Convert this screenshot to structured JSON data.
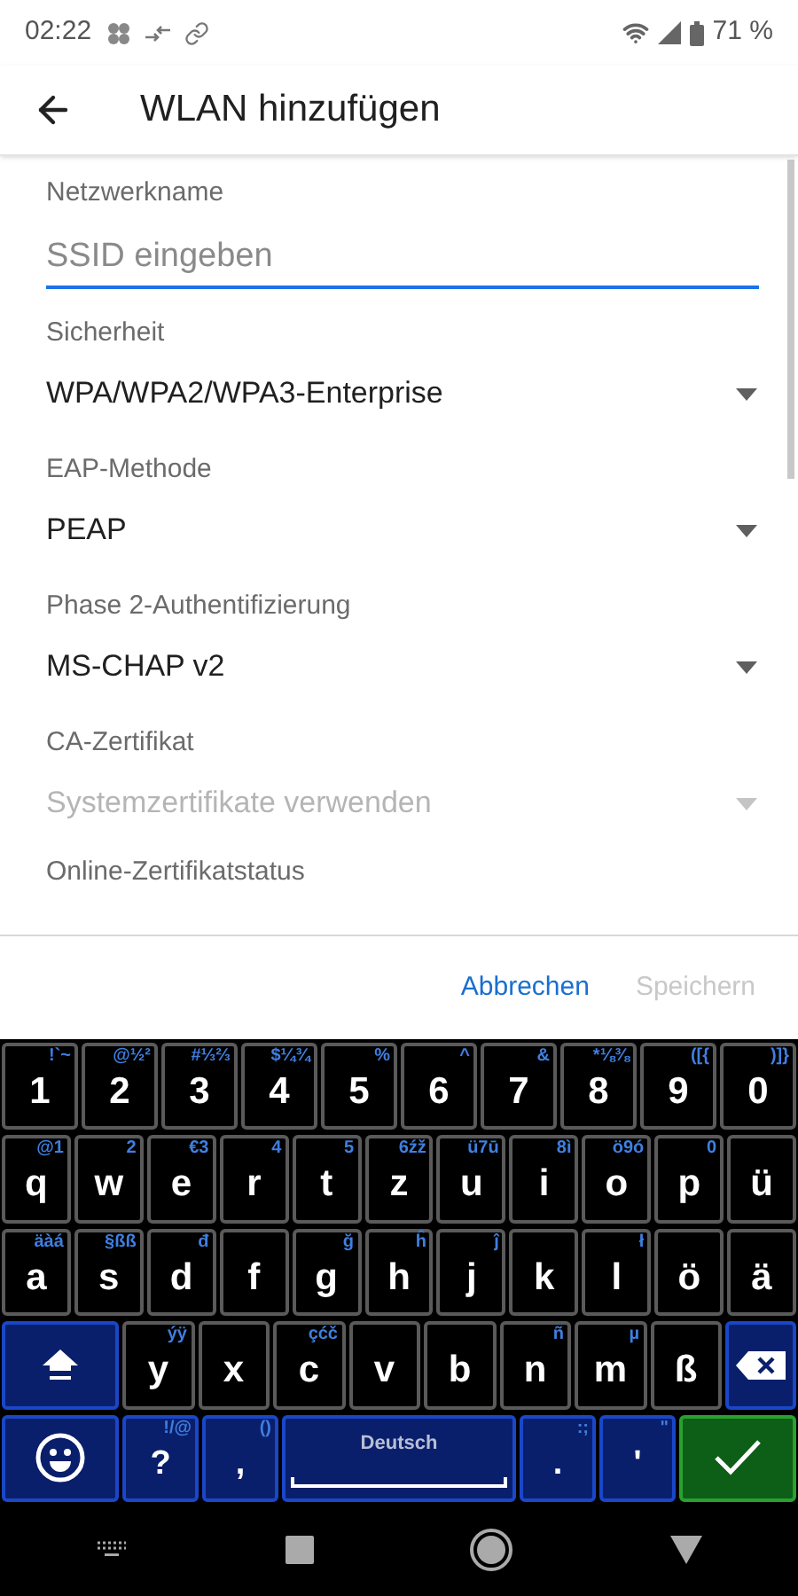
{
  "status_bar": {
    "time": "02:22",
    "battery": "71 %"
  },
  "app_bar": {
    "title": "WLAN hinzufügen"
  },
  "form": {
    "fields": [
      {
        "kind": "input",
        "label": "Netzwerkname",
        "placeholder": "SSID eingeben",
        "focused": true
      },
      {
        "kind": "dropdown",
        "label": "Sicherheit",
        "value": "WPA/WPA2/WPA3-Enterprise",
        "disabled": false
      },
      {
        "kind": "dropdown",
        "label": "EAP-Methode",
        "value": "PEAP",
        "disabled": false
      },
      {
        "kind": "dropdown",
        "label": "Phase 2-Authentifizierung",
        "value": "MS-CHAP v2",
        "disabled": false
      },
      {
        "kind": "dropdown",
        "label": "CA-Zertifikat",
        "value": "Systemzertifikate verwenden",
        "disabled": true
      },
      {
        "kind": "partial",
        "label": "Online-Zertifikatstatus"
      }
    ]
  },
  "dialog_buttons": [
    {
      "label": "Abbrechen",
      "disabled": false
    },
    {
      "label": "Speichern",
      "disabled": true
    }
  ],
  "keyboard": {
    "number_keys": [
      {
        "kind": "char",
        "label": "1",
        "hint": "!`~"
      },
      {
        "kind": "char",
        "label": "2",
        "hint": "@½²"
      },
      {
        "kind": "char",
        "label": "3",
        "hint": "#⅓⅔"
      },
      {
        "kind": "char",
        "label": "4",
        "hint": "$¼¾"
      },
      {
        "kind": "char",
        "label": "5",
        "hint": "%"
      },
      {
        "kind": "char",
        "label": "6",
        "hint": "^"
      },
      {
        "kind": "char",
        "label": "7",
        "hint": "&"
      },
      {
        "kind": "char",
        "label": "8",
        "hint": "*⅛⅜"
      },
      {
        "kind": "char",
        "label": "9",
        "hint": "([{"
      },
      {
        "kind": "char",
        "label": "0",
        "hint": ")]}"
      }
    ],
    "upper_letter_keys": [
      {
        "kind": "char",
        "label": "q",
        "hint": "@1"
      },
      {
        "kind": "char",
        "label": "w",
        "hint": "2"
      },
      {
        "kind": "char",
        "label": "e",
        "hint": "€3"
      },
      {
        "kind": "char",
        "label": "r",
        "hint": "4"
      },
      {
        "kind": "char",
        "label": "t",
        "hint": "5"
      },
      {
        "kind": "char",
        "label": "z",
        "hint": "6źž"
      },
      {
        "kind": "char",
        "label": "u",
        "hint": "ü7ū"
      },
      {
        "kind": "char",
        "label": "i",
        "hint": "8ì"
      },
      {
        "kind": "char",
        "label": "o",
        "hint": "ö9ó"
      },
      {
        "kind": "char",
        "label": "p",
        "hint": "0"
      },
      {
        "kind": "char",
        "label": "ü"
      }
    ],
    "middle_letter_keys": [
      {
        "kind": "char",
        "label": "a",
        "hint": "äàá"
      },
      {
        "kind": "char",
        "label": "s",
        "hint": "§ßß"
      },
      {
        "kind": "char",
        "label": "d",
        "hint": "đ"
      },
      {
        "kind": "char",
        "label": "f"
      },
      {
        "kind": "char",
        "label": "g",
        "hint": "ğ"
      },
      {
        "kind": "char",
        "label": "h",
        "hint": "ĥ"
      },
      {
        "kind": "char",
        "label": "j",
        "hint": "ĵ"
      },
      {
        "kind": "char",
        "label": "k"
      },
      {
        "kind": "char",
        "label": "l",
        "hint": "ł"
      },
      {
        "kind": "char",
        "label": "ö"
      },
      {
        "kind": "char",
        "label": "ä"
      }
    ],
    "lower_letter_keys": [
      {
        "kind": "shift"
      },
      {
        "kind": "char",
        "label": "y",
        "hint": "ýÿ"
      },
      {
        "kind": "char",
        "label": "x"
      },
      {
        "kind": "char",
        "label": "c",
        "hint": "çćč"
      },
      {
        "kind": "char",
        "label": "v"
      },
      {
        "kind": "char",
        "label": "b"
      },
      {
        "kind": "char",
        "label": "n",
        "hint": "ñ"
      },
      {
        "kind": "char",
        "label": "m",
        "hint": "µ"
      },
      {
        "kind": "char",
        "label": "ß"
      },
      {
        "kind": "backspace"
      }
    ],
    "function_keys": [
      {
        "kind": "emoji"
      },
      {
        "kind": "symbol",
        "label": "?",
        "hint": "!/@"
      },
      {
        "kind": "symbol",
        "label": ",",
        "hint": "()"
      },
      {
        "kind": "space",
        "label": "Deutsch"
      },
      {
        "kind": "symbol",
        "label": ".",
        "hint": ":;"
      },
      {
        "kind": "symbol",
        "label": "'",
        "hint": "\""
      },
      {
        "kind": "enter"
      }
    ]
  }
}
